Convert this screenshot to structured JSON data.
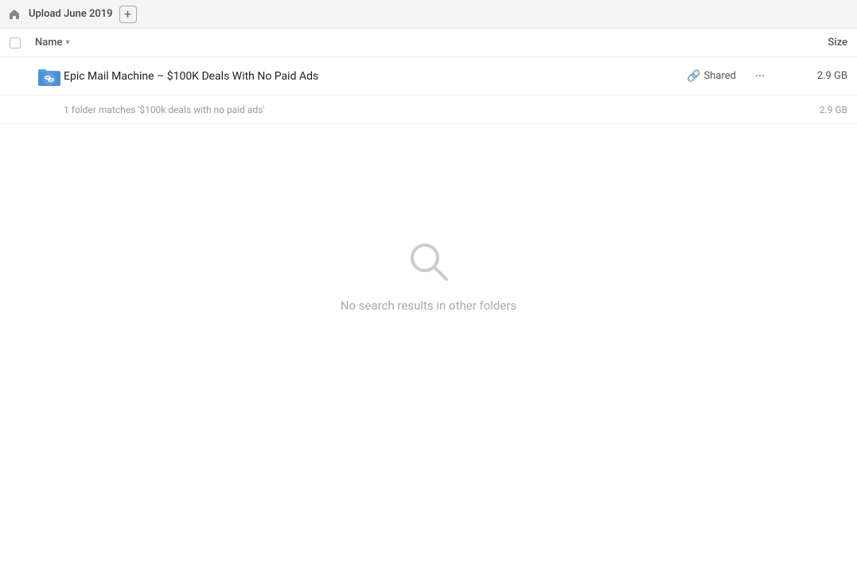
{
  "titleBar": {
    "label": "Upload June 2019",
    "addButton": "+",
    "homeIcon": "home"
  },
  "columns": {
    "nameLabel": "Name",
    "sizeLabel": "Size"
  },
  "fileRow": {
    "name": "Epic Mail Machine – $100K Deals With No Paid Ads",
    "sharedLabel": "Shared",
    "size": "2.9 GB",
    "moreIcon": "···"
  },
  "subfolderRow": {
    "text": "1 folder matches '$100k deals with no paid ads'",
    "size": "2.9 GB"
  },
  "emptyState": {
    "text": "No search results in other folders"
  }
}
